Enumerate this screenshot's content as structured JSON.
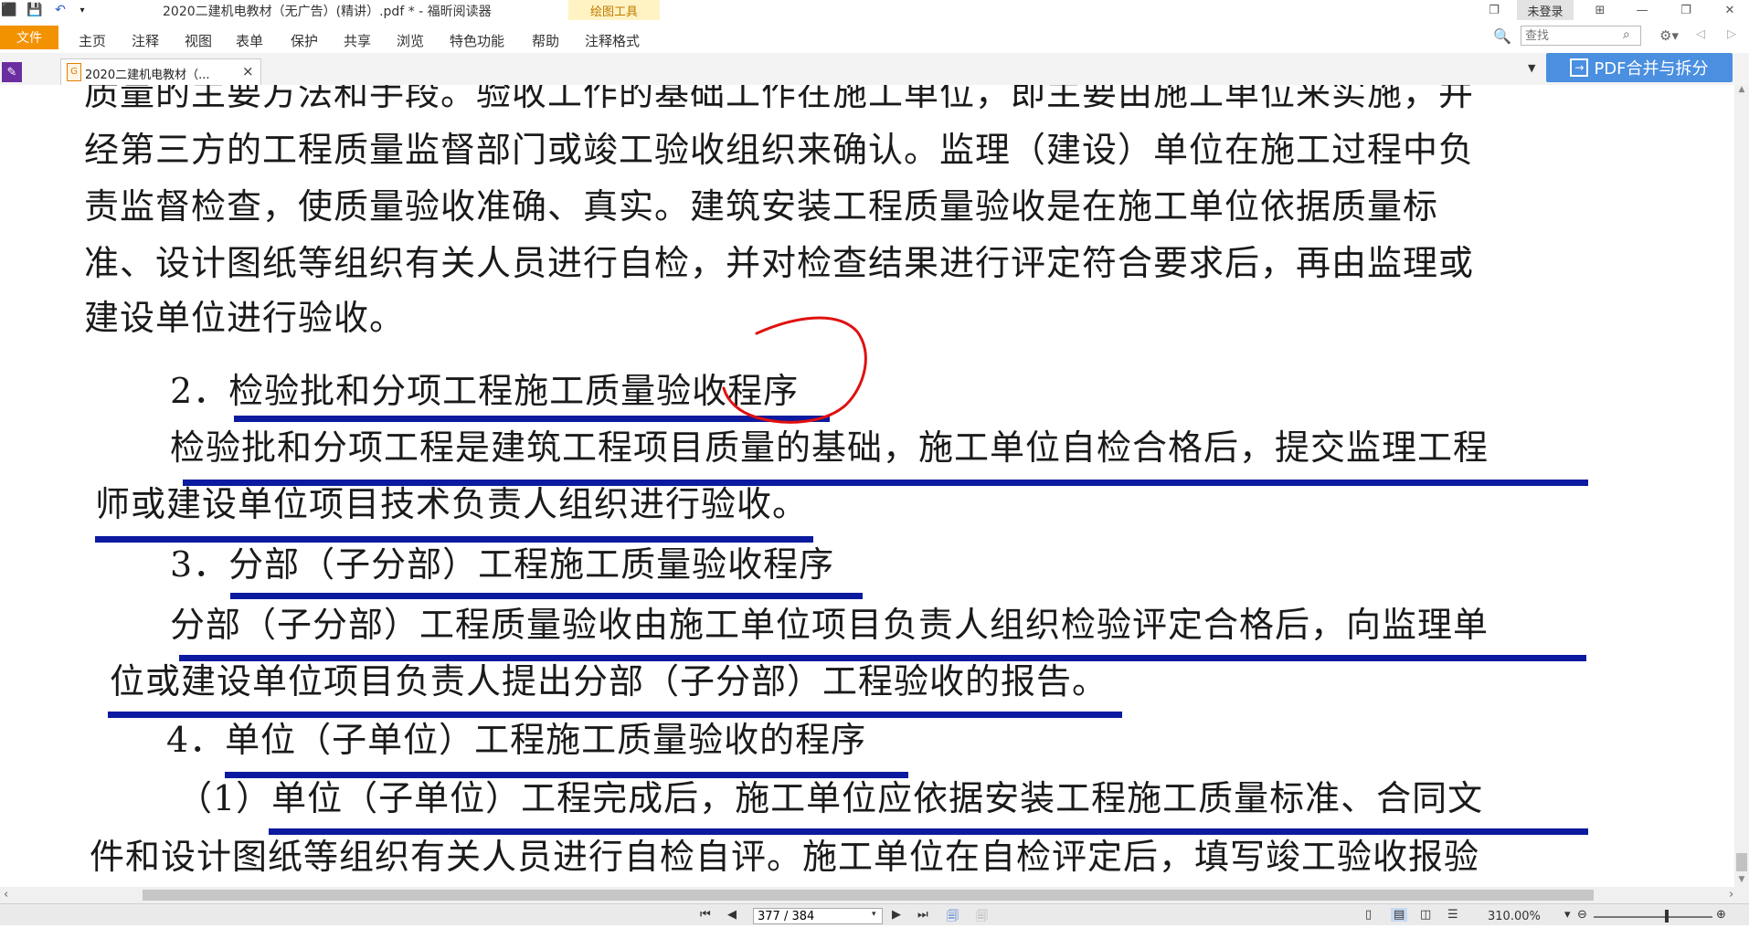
{
  "titlebar": {
    "app_title": "2020二建机电教材（无广告）(精讲）.pdf * - 福昕阅读器",
    "drawing_tools": "绘图工具",
    "login": "未登录"
  },
  "menu": {
    "file": "文件",
    "items": [
      "主页",
      "注释",
      "视图",
      "表单",
      "保护",
      "共享",
      "浏览",
      "特色功能",
      "帮助",
      "注释格式"
    ]
  },
  "search": {
    "placeholder": "查找"
  },
  "tab": {
    "label": "2020二建机电教材（...",
    "close": "×"
  },
  "promo": {
    "label": "PDF合并与拆分"
  },
  "document": {
    "lines": [
      "质量的主要方法和手段。验收工作的基础工作在施工单位，即主要由施工单位来实施，并",
      "经第三方的工程质量监督部门或竣工验收组织来确认。监理（建设）单位在施工过程中负",
      "责监督检查，使质量验收准确、真实。建筑安装工程质量验收是在施工单位依据质量标",
      "准、设计图纸等组织有关人员进行自检，并对检查结果进行评定符合要求后，再由监理或",
      "建设单位进行验收。",
      "2．检验批和分项工程施工质量验收程序",
      "检验批和分项工程是建筑工程项目质量的基础，施工单位自检合格后，提交监理工程",
      "师或建设单位项目技术负责人组织进行验收。",
      "3．分部（子分部）工程施工质量验收程序",
      "分部（子分部）工程质量验收由施工单位项目负责人组织检验评定合格后，向监理单",
      "位或建设单位项目负责人提出分部（子分部）工程验收的报告。",
      "4．单位（子单位）工程施工质量验收的程序",
      "（1）单位（子单位）工程完成后，施工单位应依据安装工程施工质量标准、合同文",
      "件和设计图纸等组织有关人员进行自检自评。施工单位在自检评定后，填写竣工验收报验"
    ]
  },
  "status": {
    "page": "377 / 384",
    "zoom": "310.00%"
  },
  "colors": {
    "accent_orange": "#f39200",
    "underline_blue": "#0b1a9e",
    "annotation_red": "#e01010",
    "promo_blue": "#4a8fe0"
  }
}
